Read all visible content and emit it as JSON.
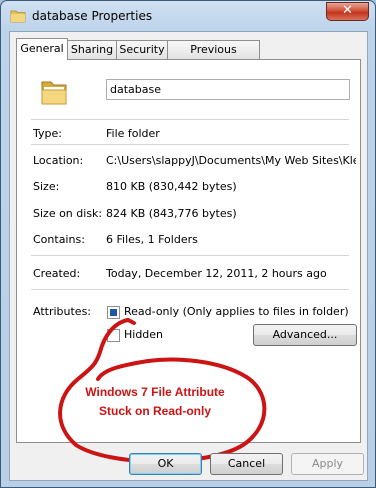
{
  "window": {
    "title": "database Properties",
    "close_label": "✕"
  },
  "tabs": [
    {
      "label": "General",
      "active": true
    },
    {
      "label": "Sharing",
      "active": false
    },
    {
      "label": "Security",
      "active": false
    },
    {
      "label": "Previous Versions",
      "active": false
    }
  ],
  "general": {
    "name_value": "database",
    "type_label": "Type:",
    "type_value": "File folder",
    "location_label": "Location:",
    "location_value": "C:\\Users\\slappyJ\\Documents\\My Web Sites\\KleenI",
    "size_label": "Size:",
    "size_value": "810 KB (830,442 bytes)",
    "size_on_disk_label": "Size on disk:",
    "size_on_disk_value": "824 KB (843,776 bytes)",
    "contains_label": "Contains:",
    "contains_value": "6 Files, 1 Folders",
    "created_label": "Created:",
    "created_value": "Today, December 12, 2011, 2 hours ago",
    "attributes_label": "Attributes:",
    "readonly_label": "Read-only (Only applies to files in folder)",
    "hidden_label": "Hidden",
    "advanced_label": "Advanced..."
  },
  "annotation": {
    "line1": "Windows 7 File Attribute",
    "line2": "Stuck on Read-only",
    "color": "#cc1414"
  },
  "footer": {
    "ok_label": "OK",
    "cancel_label": "Cancel",
    "apply_label": "Apply"
  },
  "icons": {
    "title": "folder-icon",
    "main": "folder-icon"
  }
}
